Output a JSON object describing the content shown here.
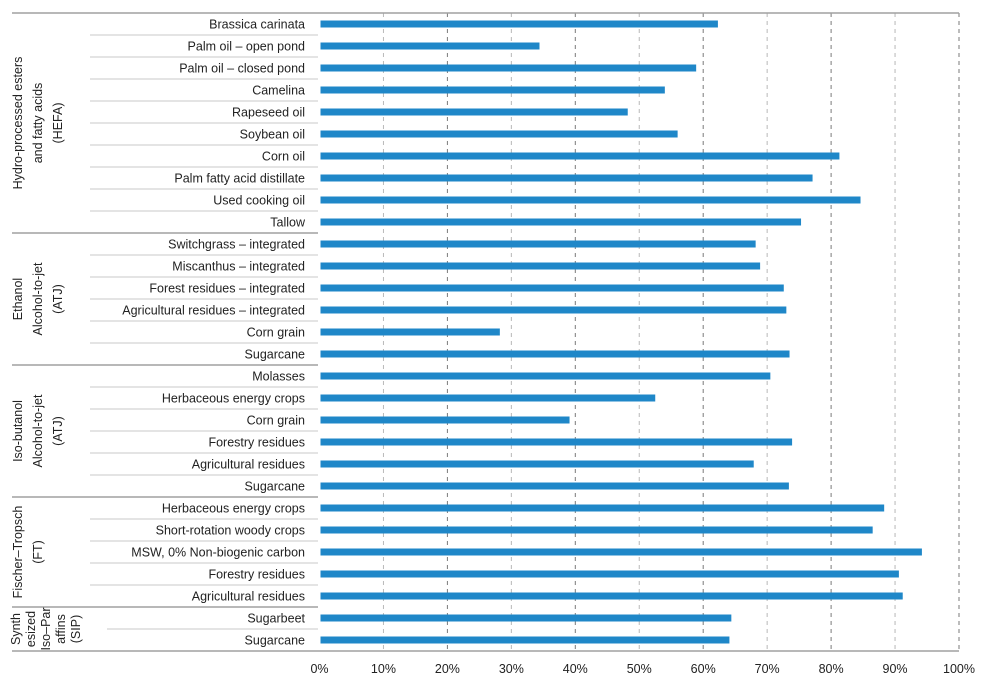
{
  "chart_data": {
    "type": "bar",
    "orientation": "horizontal",
    "title": "",
    "xlabel": "",
    "ylabel": "",
    "xlim": [
      0,
      100
    ],
    "x_ticks": [
      "0%",
      "10%",
      "20%",
      "30%",
      "40%",
      "50%",
      "60%",
      "70%",
      "80%",
      "90%",
      "100%"
    ],
    "grid": "vertical dashed",
    "bar_color": "#1f87c8",
    "groups": [
      {
        "label_lines": [
          "Hydro-processed esters",
          "and fatty acids",
          "(HEFA)"
        ],
        "categories": [
          "Brassica carinata",
          "Palm oil – open pond",
          "Palm oil – closed pond",
          "Camelina",
          "Rapeseed oil",
          "Soybean oil",
          "Corn oil",
          "Palm fatty acid distillate",
          "Used cooking oil",
          "Tallow"
        ],
        "values": [
          62.3,
          34.4,
          58.9,
          54.0,
          48.2,
          56.0,
          81.3,
          77.1,
          84.6,
          75.3
        ]
      },
      {
        "label_lines": [
          "Ethanol",
          "Alcohol-to-jet",
          "(ATJ)"
        ],
        "categories": [
          "Switchgrass – integrated",
          "Miscanthus – integrated",
          "Forest residues – integrated",
          "Agricultural residues – integrated",
          "Corn grain",
          "Sugarcane"
        ],
        "values": [
          68.2,
          68.9,
          72.6,
          73.0,
          28.2,
          73.5
        ]
      },
      {
        "label_lines": [
          "Iso-butanol",
          "Alcohol-to-jet",
          "(ATJ)"
        ],
        "categories": [
          "Molasses",
          "Herbaceous energy crops",
          "Corn grain",
          "Forestry residues",
          "Agricultural residues",
          "Sugarcane"
        ],
        "values": [
          70.5,
          52.5,
          39.1,
          73.9,
          67.9,
          73.4
        ]
      },
      {
        "label_lines": [
          "Fischer–Tropsch",
          "(FT)"
        ],
        "categories": [
          "Herbaceous energy crops",
          "Short-rotation woody crops",
          "MSW, 0% Non-biogenic carbon",
          "Forestry residues",
          "Agricultural residues"
        ],
        "values": [
          88.3,
          86.5,
          94.2,
          90.6,
          91.2
        ]
      },
      {
        "label_lines": [
          "Synth",
          "esized",
          "Iso–Par",
          "affins",
          "(SIP)"
        ],
        "categories": [
          "Sugarbeet",
          "Sugarcane"
        ],
        "values": [
          64.4,
          64.1
        ]
      }
    ]
  }
}
